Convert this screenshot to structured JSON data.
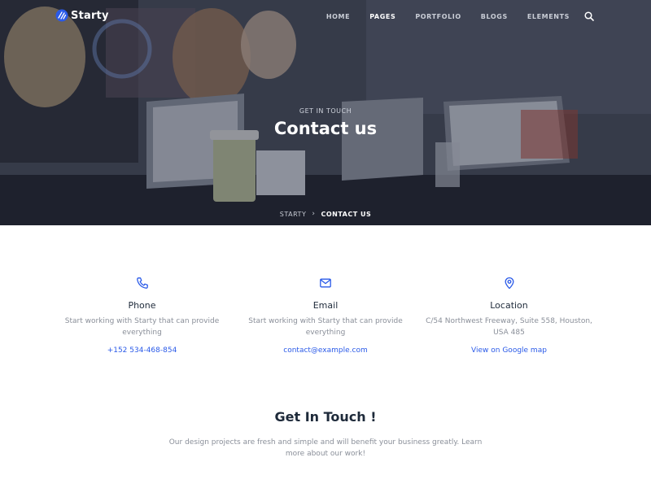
{
  "brand": {
    "name": "Starty"
  },
  "nav": {
    "items": [
      {
        "label": "HOME",
        "active": false
      },
      {
        "label": "PAGES",
        "active": true
      },
      {
        "label": "PORTFOLIO",
        "active": false
      },
      {
        "label": "BLOGS",
        "active": false
      },
      {
        "label": "ELEMENTS",
        "active": false
      }
    ],
    "search_icon": "search-icon"
  },
  "hero": {
    "kicker": "GET IN TOUCH",
    "title": "Contact us",
    "breadcrumb": {
      "home": "STARTY",
      "separator": "›",
      "current": "CONTACT US"
    }
  },
  "contacts": [
    {
      "icon": "phone-icon",
      "title": "Phone",
      "description": "Start working with Starty that can provide everything",
      "link": "+152 534-468-854"
    },
    {
      "icon": "mail-icon",
      "title": "Email",
      "description": "Start working with Starty that can provide everything",
      "link": "contact@example.com"
    },
    {
      "icon": "map-pin-icon",
      "title": "Location",
      "description": "C/54 Northwest Freeway, Suite 558, Houston, USA 485",
      "link": "View on Google map"
    }
  ],
  "get_in_touch": {
    "title": "Get In Touch !",
    "text": "Our design projects are fresh and simple and will benefit your business greatly. Learn more about our work!"
  },
  "colors": {
    "accent": "#2a5ae8",
    "heading": "#1e2a3a",
    "muted": "#8a8f99",
    "hero_overlay": "#1c2234"
  }
}
